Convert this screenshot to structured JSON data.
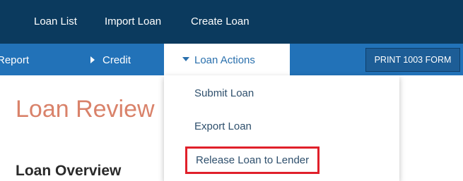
{
  "top_nav": {
    "tabs": [
      {
        "label": "Loan List"
      },
      {
        "label": "Import Loan"
      },
      {
        "label": "Create Loan"
      }
    ]
  },
  "sub_nav": {
    "report_label": "Report",
    "credit_label": "Credit",
    "loan_actions_label": "Loan Actions",
    "print_button_label": "PRINT 1003 FORM"
  },
  "page": {
    "title": "Loan Review",
    "section_title": "Loan Overview"
  },
  "loan_actions_menu": {
    "items": [
      {
        "label": "Submit Loan"
      },
      {
        "label": "Export Loan"
      },
      {
        "label": "Release Loan to Lender",
        "highlighted": true
      }
    ]
  },
  "colors": {
    "top_bar": "#0b3a5e",
    "sub_bar": "#2272b8",
    "title_accent": "#d9826a",
    "highlight_border": "#e0202a"
  }
}
